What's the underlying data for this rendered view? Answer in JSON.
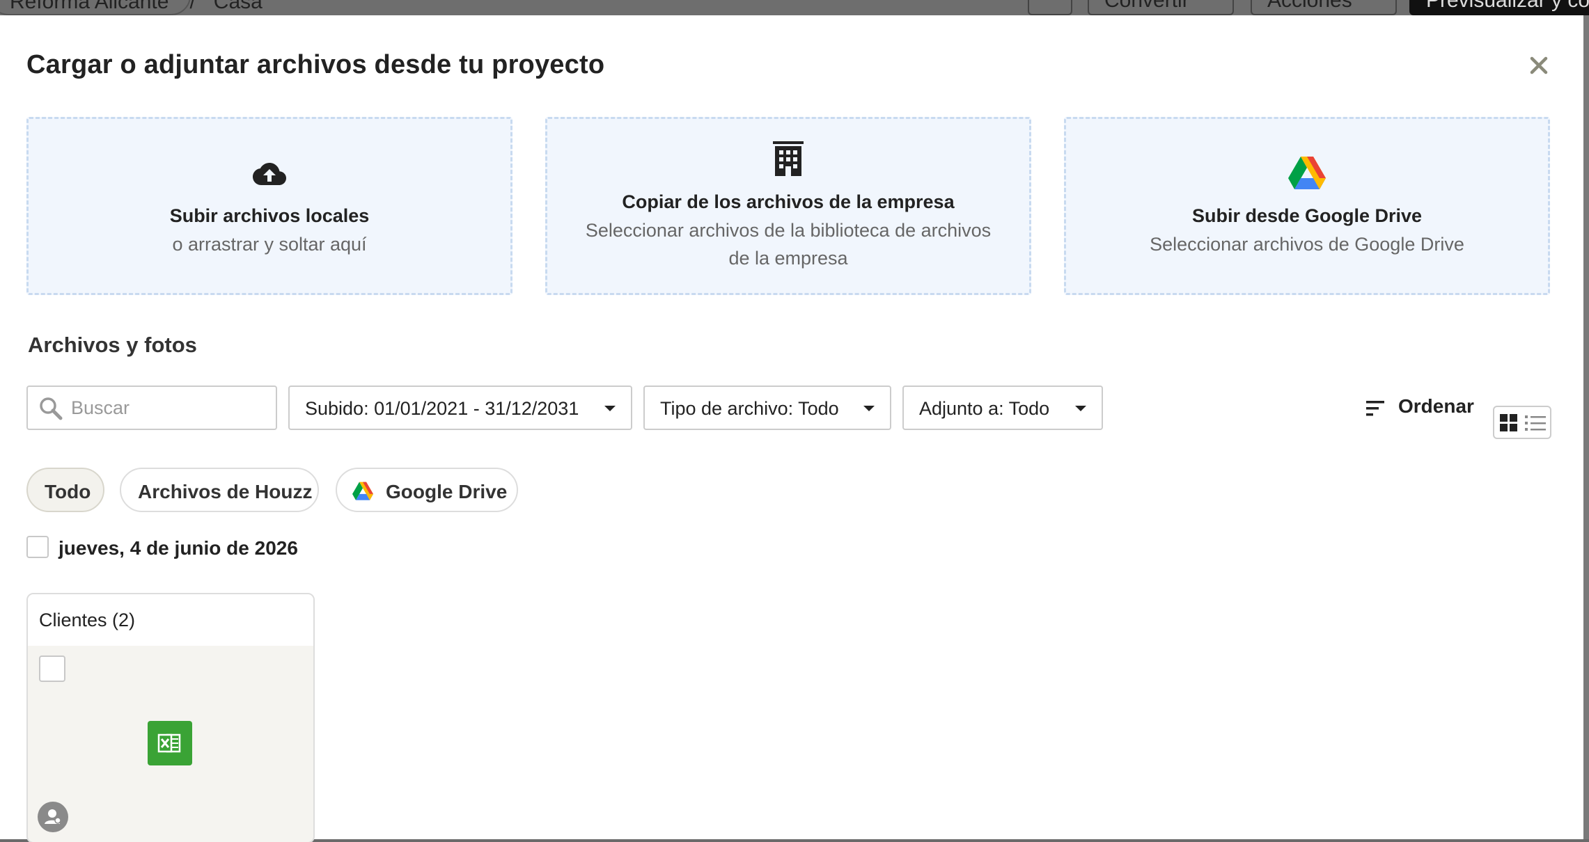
{
  "background": {
    "breadcrumb": {
      "project": "Reforma Alicante",
      "separator": "/",
      "page": "Casa"
    },
    "buttons": {
      "convert": "Convertir",
      "actions": "Acciones",
      "preview": "Previsualizar y co"
    }
  },
  "modal": {
    "title": "Cargar o adjuntar archivos desde tu proyecto",
    "close_icon": "close-icon",
    "upload_options": [
      {
        "icon": "cloud-upload-icon",
        "title": "Subir archivos locales",
        "subtitle": "o arrastrar y soltar aquí"
      },
      {
        "icon": "building-icon",
        "title": "Copiar de los archivos de la empresa",
        "subtitle": "Seleccionar archivos de la biblioteca de archivos de la empresa"
      },
      {
        "icon": "google-drive-icon",
        "title": "Subir desde Google Drive",
        "subtitle": "Seleccionar archivos de Google Drive"
      }
    ],
    "section_title": "Archivos y fotos",
    "search": {
      "placeholder": "Buscar",
      "value": ""
    },
    "filters": {
      "uploaded": "Subido: 01/01/2021 - 31/12/2031",
      "file_type": "Tipo de archivo: Todo",
      "attached_to": "Adjunto a: Todo"
    },
    "sort_label": "Ordenar",
    "view_mode": "grid",
    "source_chips": [
      {
        "label": "Todo",
        "active": true
      },
      {
        "label": "Archivos de Houzz",
        "active": false
      },
      {
        "label": "Google Drive",
        "active": false,
        "icon": "google-drive-icon"
      }
    ],
    "date_group": {
      "label": "jueves, 4 de junio de 2026",
      "checked": false
    },
    "folders": [
      {
        "name": "Clientes (2)",
        "file_icon": "excel-icon",
        "owner_icon": "user-avatar-icon"
      }
    ],
    "colors": {
      "card_bg": "#f1f6fd",
      "card_border": "#c8daf0",
      "excel_green": "#3aa335",
      "chip_active_bg": "#f3f2ed"
    }
  }
}
